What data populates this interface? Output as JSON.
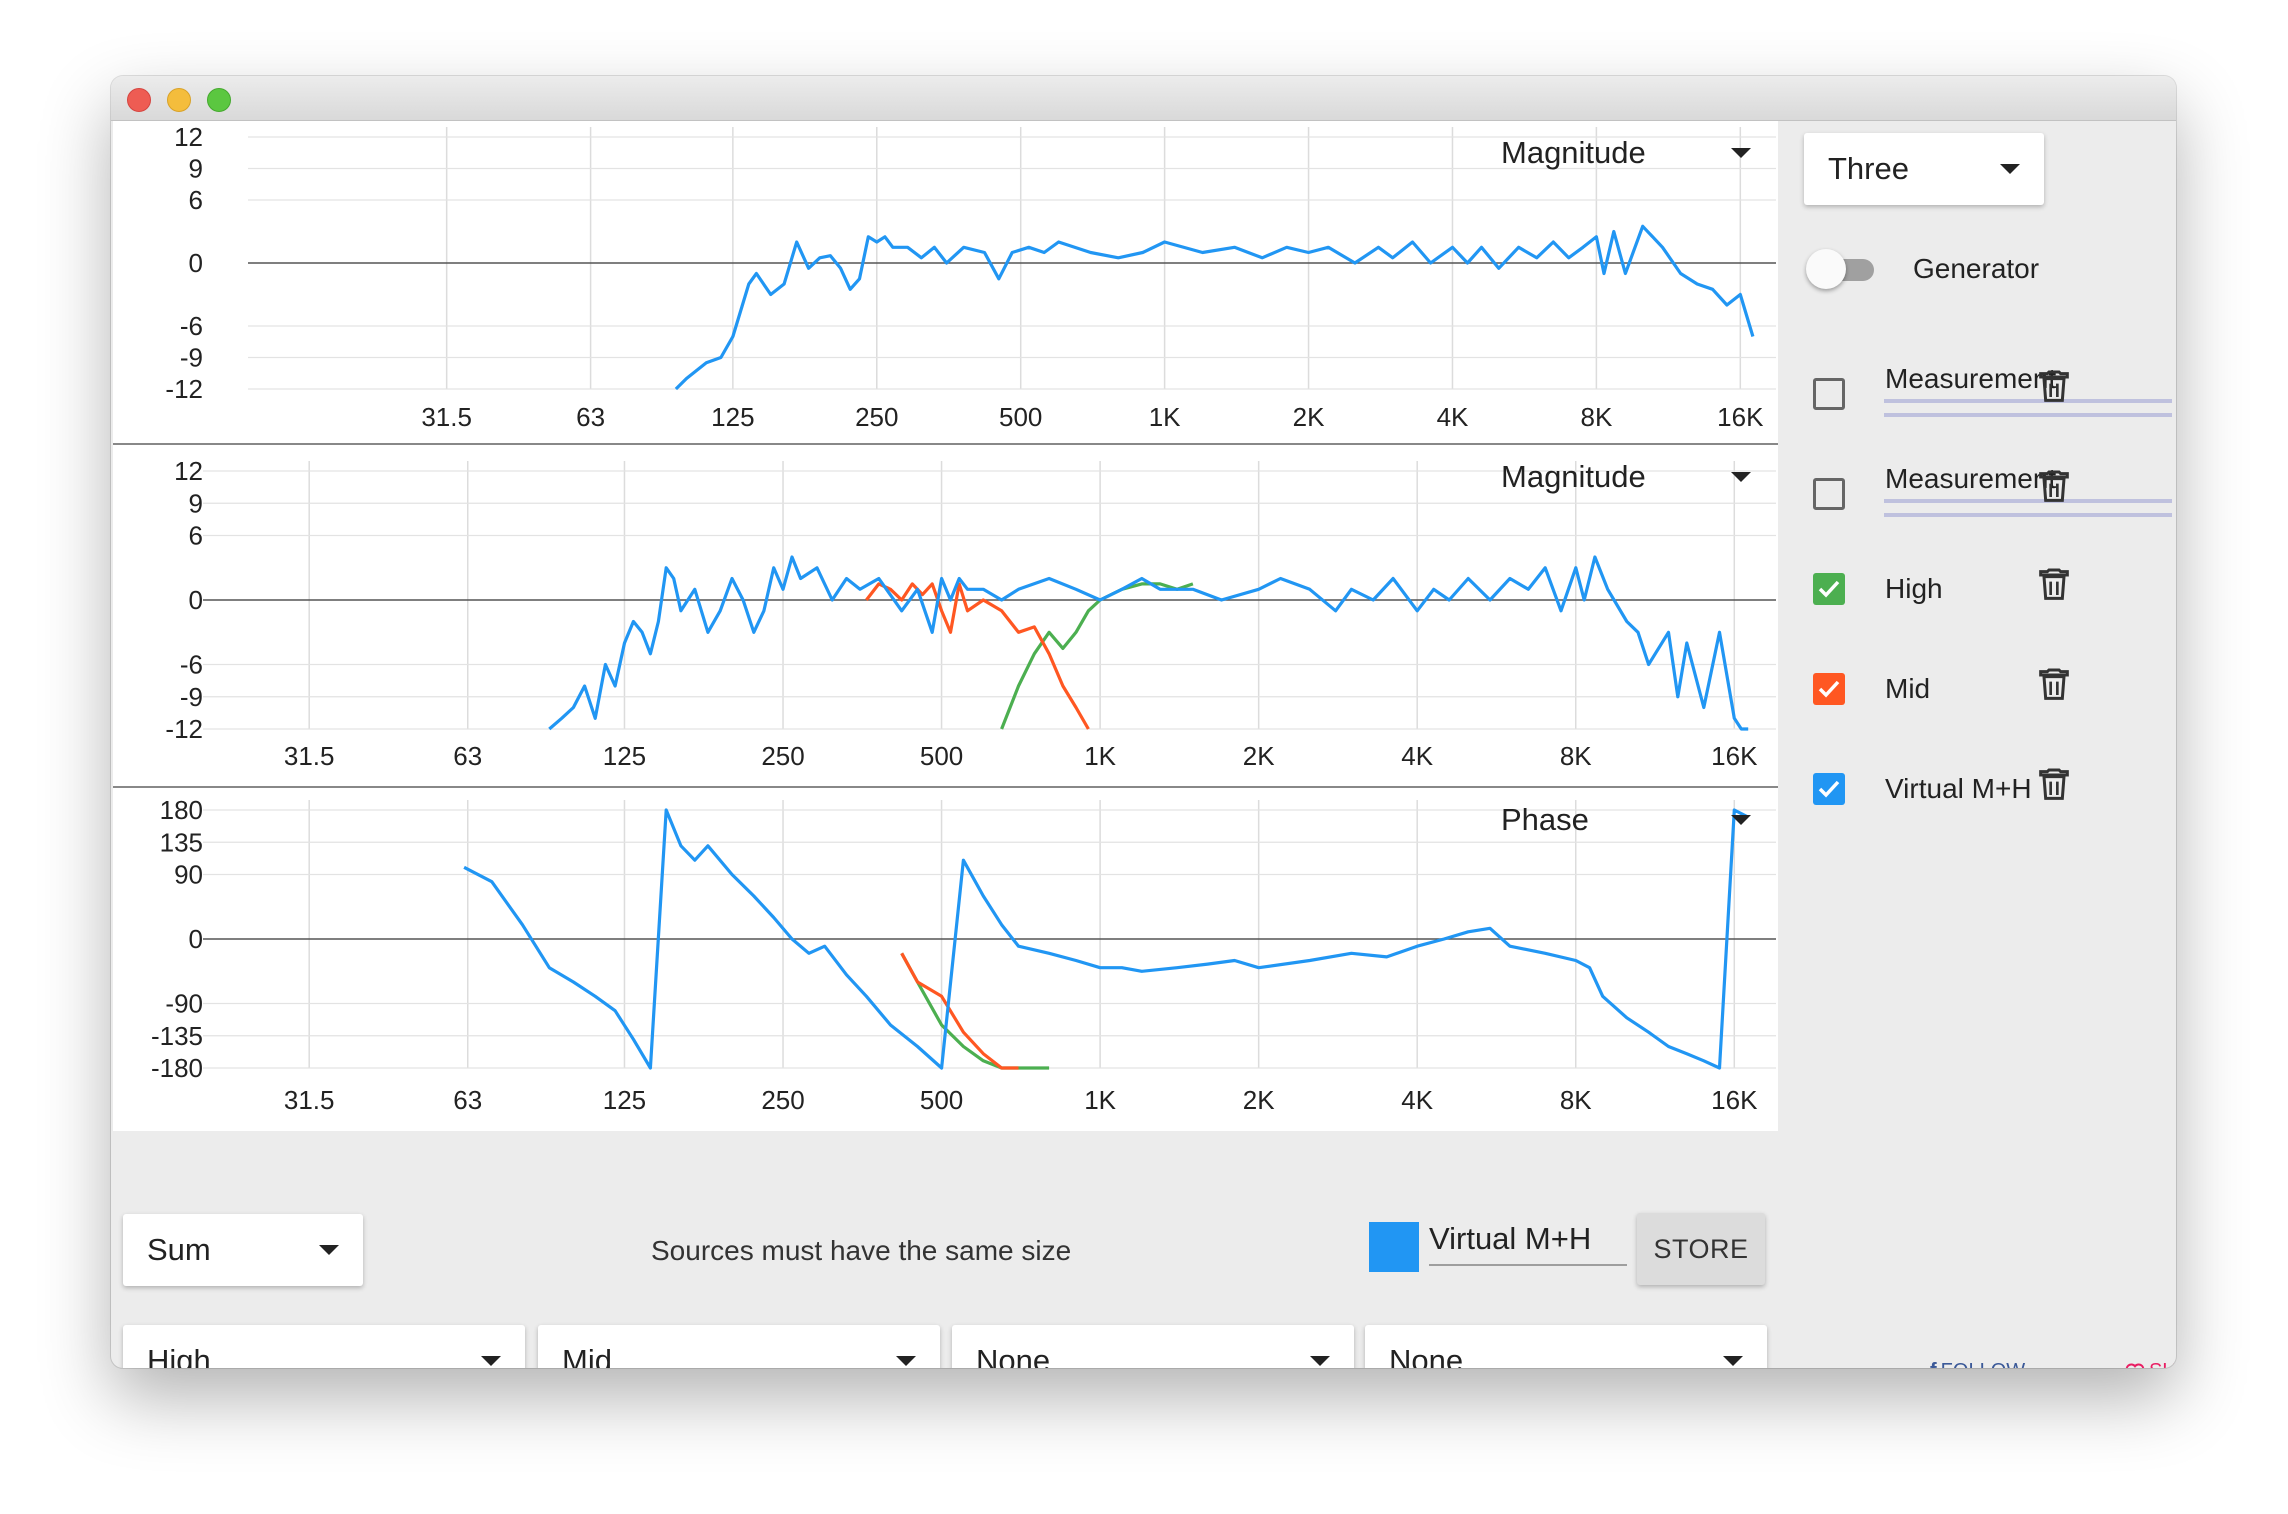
{
  "window": {
    "title": ""
  },
  "colors": {
    "virtual": "#2196f3",
    "high": "#4caf50",
    "mid": "#ff5722",
    "measurement": "#5bd8f0",
    "grid": "#dddddd",
    "zero_line": "#555555"
  },
  "charts": [
    {
      "name": "magnitude-chart-top",
      "selector": "Magnitude",
      "y_ticks": [
        "12",
        "9",
        "6",
        "0",
        "-6",
        "-9",
        "-12"
      ],
      "x_ticks": [
        "31.5",
        "63",
        "125",
        "250",
        "500",
        "1K",
        "2K",
        "4K",
        "8K",
        "16K"
      ]
    },
    {
      "name": "magnitude-chart-middle",
      "selector": "Magnitude",
      "y_ticks": [
        "12",
        "9",
        "6",
        "0",
        "-6",
        "-9",
        "-12"
      ],
      "x_ticks": [
        "31.5",
        "63",
        "125",
        "250",
        "500",
        "1K",
        "2K",
        "4K",
        "8K",
        "16K"
      ]
    },
    {
      "name": "phase-chart",
      "selector": "Phase",
      "y_ticks": [
        "180",
        "135",
        "90",
        "0",
        "-90",
        "-135",
        "-180"
      ],
      "x_ticks": [
        "31.5",
        "63",
        "125",
        "250",
        "500",
        "1K",
        "2K",
        "4K",
        "8K",
        "16K"
      ]
    }
  ],
  "chart_data": [
    {
      "type": "line",
      "ylim": [
        -12,
        12
      ],
      "x_scale": "log",
      "xlim": [
        20,
        18000
      ],
      "series": [
        {
          "color": "#2196f3",
          "x": [
            95,
            100,
            110,
            118,
            125,
            135,
            140,
            150,
            160,
            170,
            180,
            190,
            200,
            210,
            220,
            230,
            240,
            250,
            260,
            270,
            290,
            310,
            330,
            350,
            380,
            420,
            450,
            480,
            520,
            560,
            600,
            700,
            800,
            900,
            1000,
            1200,
            1400,
            1600,
            1800,
            2000,
            2200,
            2500,
            2800,
            3000,
            3300,
            3600,
            4000,
            4300,
            4600,
            5000,
            5500,
            6000,
            6500,
            7000,
            7500,
            8000,
            8300,
            8700,
            9200,
            10000,
            11000,
            12000,
            13000,
            14000,
            15000,
            16000,
            17000
          ],
          "y": [
            -12,
            -11,
            -9.5,
            -9,
            -7,
            -2,
            -1,
            -3,
            -2,
            2,
            -0.5,
            0.5,
            0.7,
            -0.5,
            -2.5,
            -1.5,
            2.5,
            2,
            2.5,
            1.5,
            1.5,
            0.5,
            1.5,
            0,
            1.5,
            1,
            -1.5,
            1,
            1.5,
            1,
            2,
            1,
            0.5,
            1,
            2,
            1,
            1.5,
            0.5,
            1.5,
            1,
            1.5,
            0,
            1.5,
            0.5,
            2,
            0,
            1.5,
            0,
            1.5,
            -0.5,
            1.5,
            0.5,
            2,
            0.5,
            1.5,
            2.5,
            -1,
            3,
            -1,
            3.5,
            1.5,
            -1,
            -2,
            -2.5,
            -4,
            -3,
            -7
          ]
        }
      ]
    },
    {
      "type": "line",
      "ylim": [
        -12,
        12
      ],
      "x_scale": "log",
      "xlim": [
        20,
        18000
      ],
      "series": [
        {
          "name": "High",
          "color": "#4caf50",
          "x": [
            650,
            700,
            750,
            800,
            850,
            900,
            950,
            1000,
            1100,
            1200,
            1300,
            1400,
            1500
          ],
          "y": [
            -12,
            -8,
            -5,
            -3,
            -4.5,
            -3,
            -1,
            0,
            1,
            1.5,
            1.5,
            1,
            1.5
          ]
        },
        {
          "name": "Mid",
          "color": "#ff5722",
          "x": [
            360,
            380,
            400,
            420,
            440,
            460,
            480,
            500,
            520,
            540,
            560,
            600,
            650,
            700,
            750,
            800,
            850,
            900,
            950
          ],
          "y": [
            0,
            1.5,
            1,
            0,
            1.5,
            0.5,
            1.5,
            -1,
            -3,
            1.5,
            -1,
            0,
            -1,
            -3,
            -2.5,
            -5,
            -8,
            -10,
            -12
          ]
        },
        {
          "name": "Virtual M+H",
          "color": "#2196f3",
          "x": [
            90,
            95,
            100,
            105,
            110,
            115,
            120,
            125,
            130,
            135,
            140,
            145,
            150,
            155,
            160,
            170,
            180,
            190,
            200,
            210,
            220,
            230,
            240,
            250,
            260,
            270,
            290,
            310,
            330,
            350,
            380,
            420,
            450,
            480,
            500,
            520,
            540,
            560,
            600,
            650,
            700,
            800,
            900,
            1000,
            1100,
            1200,
            1300,
            1500,
            1700,
            2000,
            2200,
            2500,
            2800,
            3000,
            3300,
            3600,
            4000,
            4300,
            4600,
            5000,
            5500,
            6000,
            6500,
            7000,
            7500,
            8000,
            8300,
            8700,
            9200,
            10000,
            10500,
            11000,
            12000,
            12500,
            13000,
            14000,
            15000,
            16000,
            16500,
            17000
          ],
          "y": [
            -12,
            -11,
            -10,
            -8,
            -11,
            -6,
            -8,
            -4,
            -2,
            -3,
            -5,
            -2,
            3,
            2,
            -1,
            1,
            -3,
            -1,
            2,
            0,
            -3,
            -1,
            3,
            1,
            4,
            2,
            3,
            0,
            2,
            1,
            2,
            -1,
            1,
            -3,
            2,
            0,
            2,
            1,
            1,
            0,
            1,
            2,
            1,
            0,
            1,
            2,
            1,
            1,
            0,
            1,
            2,
            1,
            -1,
            1,
            0,
            2,
            -1,
            1,
            0,
            2,
            0,
            2,
            1,
            3,
            -1,
            3,
            0,
            4,
            1,
            -2,
            -3,
            -6,
            -3,
            -9,
            -4,
            -10,
            -3,
            -11,
            -12,
            -12
          ]
        }
      ]
    },
    {
      "type": "line",
      "ylim": [
        -180,
        180
      ],
      "x_scale": "log",
      "xlim": [
        20,
        18000
      ],
      "series": [
        {
          "name": "High",
          "color": "#4caf50",
          "x": [
            420,
            450,
            500,
            550,
            600,
            650,
            700,
            750,
            800
          ],
          "y": [
            -20,
            -60,
            -120,
            -150,
            -170,
            -180,
            -180,
            -180,
            -180
          ]
        },
        {
          "name": "Mid",
          "color": "#ff5722",
          "x": [
            420,
            450,
            500,
            550,
            600,
            650,
            700
          ],
          "y": [
            -20,
            -60,
            -80,
            -130,
            -160,
            -180,
            -180
          ]
        },
        {
          "name": "Virtual M+H",
          "color": "#2196f3",
          "x": [
            62,
            70,
            80,
            90,
            100,
            110,
            120,
            130,
            140,
            150,
            160,
            170,
            180,
            200,
            220,
            240,
            260,
            280,
            300,
            330,
            360,
            400,
            450,
            500,
            550,
            600,
            650,
            700,
            800,
            900,
            1000,
            1100,
            1200,
            1400,
            1600,
            1800,
            2000,
            2500,
            3000,
            3500,
            4000,
            4500,
            5000,
            5500,
            6000,
            7000,
            8000,
            8500,
            9000,
            10000,
            11000,
            12000,
            13000,
            14000,
            15000,
            16000,
            17000
          ],
          "y": [
            100,
            80,
            20,
            -40,
            -60,
            -80,
            -100,
            -140,
            -180,
            180,
            130,
            110,
            130,
            90,
            60,
            30,
            0,
            -20,
            -10,
            -50,
            -80,
            -120,
            -150,
            -180,
            110,
            60,
            20,
            -10,
            -20,
            -30,
            -40,
            -40,
            -45,
            -40,
            -35,
            -30,
            -40,
            -30,
            -20,
            -25,
            -10,
            0,
            10,
            15,
            -10,
            -20,
            -30,
            -40,
            -80,
            -110,
            -130,
            -150,
            -160,
            -170,
            -180,
            180,
            170
          ]
        }
      ]
    }
  ],
  "sidebar": {
    "view_select": {
      "value": "Three"
    },
    "generator": {
      "label": "Generator",
      "on": false
    },
    "measurements": [
      {
        "label": "Measurement",
        "checked": false,
        "color": "#666666"
      },
      {
        "label": "Measurement",
        "checked": false,
        "color": "#666666"
      },
      {
        "label": "High",
        "checked": true,
        "color": "#4caf50"
      },
      {
        "label": "Mid",
        "checked": true,
        "color": "#ff5722"
      },
      {
        "label": "Virtual M+H",
        "checked": true,
        "color": "#2196f3"
      }
    ],
    "follow": "FOLLOW",
    "support": "SUPPORT"
  },
  "bottom": {
    "operation_select": {
      "value": "Sum"
    },
    "hint": "Sources must have the same size",
    "virtual_name": "Virtual M+H",
    "store_label": "STORE",
    "sources": [
      {
        "value": "High"
      },
      {
        "value": "Mid"
      },
      {
        "value": "None"
      },
      {
        "value": "None"
      }
    ]
  }
}
